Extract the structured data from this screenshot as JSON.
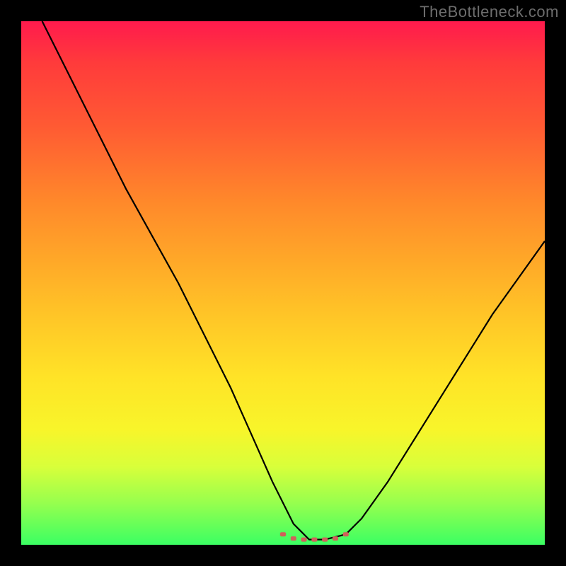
{
  "watermark": "TheBottleneck.com",
  "colors": {
    "background": "#000000",
    "gradient_top": "#ff1a4d",
    "gradient_mid": "#ffe327",
    "gradient_bottom": "#3bff63",
    "line": "#000000",
    "marker": "#d0615a"
  },
  "chart_data": {
    "type": "line",
    "title": "",
    "xlabel": "",
    "ylabel": "",
    "xlim": [
      0,
      100
    ],
    "ylim": [
      0,
      100
    ],
    "series": [
      {
        "name": "curve",
        "x": [
          4,
          10,
          20,
          30,
          40,
          48,
          52,
          55,
          58,
          62,
          65,
          70,
          80,
          90,
          100
        ],
        "values": [
          100,
          88,
          68,
          50,
          30,
          12,
          4,
          1,
          1,
          2,
          5,
          12,
          28,
          44,
          58
        ]
      }
    ],
    "markers": {
      "name": "highlight",
      "x": [
        50,
        52,
        54,
        56,
        58,
        60,
        62
      ],
      "values": [
        2.0,
        1.2,
        1.0,
        1.0,
        1.0,
        1.2,
        2.0
      ]
    }
  }
}
